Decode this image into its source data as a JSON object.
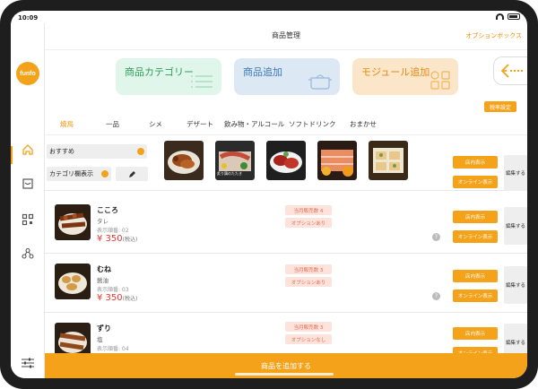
{
  "status": {
    "time": "10:09"
  },
  "header": {
    "title": "商品管理",
    "option_box": "オプションボックス"
  },
  "brand": {
    "logo": "funfo"
  },
  "cards": {
    "category": "商品カテゴリー",
    "add_product": "商品追加",
    "module_add": "モジュール追加"
  },
  "tax_setting": "税率設定",
  "tabs": [
    "焼鳥",
    "一品",
    "シメ",
    "デザート",
    "飲み物・アルコール",
    "ソフトドリンク",
    "おまかせ"
  ],
  "featured": {
    "recommended": "おすすめ",
    "category_display": "カテゴリ欄表示",
    "thumb_caption": "炙り鶏のたたき"
  },
  "buttons": {
    "store_display": "店内表示",
    "online_display": "オンライン表示",
    "edit": "編集する"
  },
  "products": [
    {
      "name": "こころ",
      "sub": "タレ",
      "order": "表示順番: 02",
      "price": "¥ 350",
      "tax": "(税込)",
      "sold": "当月販売数 4",
      "option": "オプションあり"
    },
    {
      "name": "むね",
      "sub": "醤油",
      "order": "表示順番: 03",
      "price": "¥ 350",
      "tax": "(税込)",
      "sold": "当月販売数 3",
      "option": "オプションあり"
    },
    {
      "name": "ずり",
      "sub": "塩",
      "order": "表示順番: 04",
      "price": "",
      "tax": "",
      "sold": "当月販売数 3",
      "option": "オプションなし"
    }
  ],
  "bottom": {
    "add_product": "商品を追加する"
  },
  "colors": {
    "accent": "#f5a21b",
    "price": "#e53a2c",
    "tag_bg": "#fde3dc"
  }
}
